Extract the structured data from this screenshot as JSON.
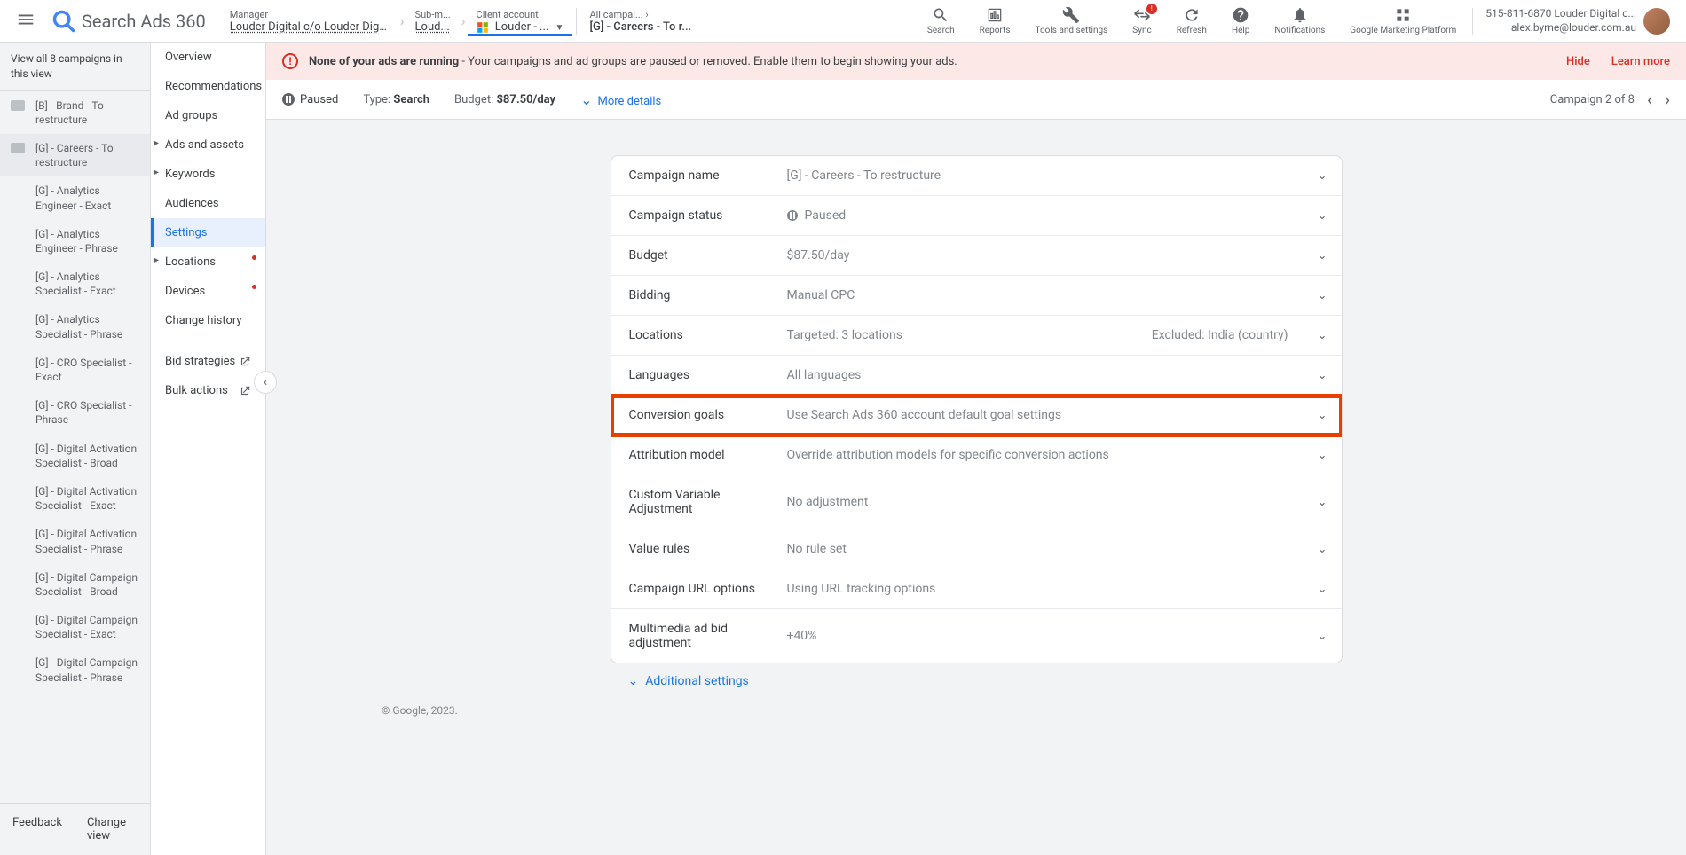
{
  "app": {
    "name": "Search Ads 360"
  },
  "breadcrumb": {
    "manager": {
      "label": "Manager",
      "value": "Louder Digital c/o Louder Digital..."
    },
    "submanager": {
      "label": "Sub-m...",
      "value": "Loud..."
    },
    "client": {
      "label": "Client account",
      "value": "Louder - ..."
    },
    "scope": {
      "label": "All campai...",
      "value": "[G] - Careers - To r..."
    }
  },
  "topActions": {
    "search": "Search",
    "reports": "Reports",
    "tools": "Tools and settings",
    "sync": "Sync",
    "syncBadge": "!",
    "refresh": "Refresh",
    "help": "Help",
    "notifications": "Notifications",
    "gmp": "Google Marketing Platform"
  },
  "user": {
    "line1": "515-811-6870 Louder Digital c...",
    "line2": "alex.byrne@louder.com.au"
  },
  "sidebar": {
    "viewAll": "View all 8 campaigns in this view",
    "items": [
      {
        "label": "[B] - Brand - To restructure",
        "icon": true
      },
      {
        "label": "[G] - Careers - To restructure",
        "icon": true,
        "selected": true
      },
      {
        "label": "[G] - Analytics Engineer - Exact"
      },
      {
        "label": "[G] - Analytics Engineer - Phrase"
      },
      {
        "label": "[G] - Analytics Specialist - Exact"
      },
      {
        "label": "[G] - Analytics Specialist - Phrase"
      },
      {
        "label": "[G] - CRO Specialist - Exact"
      },
      {
        "label": "[G] - CRO Specialist - Phrase"
      },
      {
        "label": "[G] - Digital Activation Specialist - Broad"
      },
      {
        "label": "[G] - Digital Activation Specialist - Exact"
      },
      {
        "label": "[G] - Digital Activation Specialist - Phrase"
      },
      {
        "label": "[G] - Digital Campaign Specialist - Broad"
      },
      {
        "label": "[G] - Digital Campaign Specialist - Exact"
      },
      {
        "label": "[G] - Digital Campaign Specialist - Phrase"
      }
    ],
    "footer": {
      "feedback": "Feedback",
      "changeView": "Change view"
    }
  },
  "nav2": {
    "items": [
      {
        "label": "Overview"
      },
      {
        "label": "Recommendations"
      },
      {
        "label": "Ad groups"
      },
      {
        "label": "Ads and assets",
        "exp": true
      },
      {
        "label": "Keywords",
        "exp": true
      },
      {
        "label": "Audiences"
      },
      {
        "label": "Settings",
        "active": true
      },
      {
        "label": "Locations",
        "exp": true,
        "dot": true
      },
      {
        "label": "Devices",
        "dot": true
      },
      {
        "label": "Change history"
      }
    ],
    "extras": [
      {
        "label": "Bid strategies"
      },
      {
        "label": "Bulk actions"
      }
    ]
  },
  "alert": {
    "strong": "None of your ads are running",
    "rest": " - Your campaigns and ad groups are paused or removed. Enable them to begin showing your ads.",
    "hide": "Hide",
    "learn": "Learn more"
  },
  "summary": {
    "status": "Paused",
    "typeLabel": "Type:",
    "typeValue": "Search",
    "budgetLabel": "Budget:",
    "budgetValue": "$87.50/day",
    "more": "More details",
    "position": "Campaign 2 of 8"
  },
  "settings": [
    {
      "label": "Campaign name",
      "value": "[G] - Careers - To restructure"
    },
    {
      "label": "Campaign status",
      "value": "Paused",
      "paused": true
    },
    {
      "label": "Budget",
      "value": "$87.50/day"
    },
    {
      "label": "Bidding",
      "value": "Manual CPC"
    },
    {
      "label": "Locations",
      "value": "Targeted: 3 locations",
      "extra": "Excluded: India (country)"
    },
    {
      "label": "Languages",
      "value": "All languages"
    },
    {
      "label": "Conversion goals",
      "value": "Use Search Ads 360 account default goal settings",
      "highlight": true
    },
    {
      "label": "Attribution model",
      "value": "Override attribution models for specific conversion actions"
    },
    {
      "label": "Custom Variable Adjustment",
      "value": "No adjustment"
    },
    {
      "label": "Value rules",
      "value": "No rule set"
    },
    {
      "label": "Campaign URL options",
      "value": "Using URL tracking options"
    },
    {
      "label": "Multimedia ad bid adjustment",
      "value": "+40%"
    }
  ],
  "additional": "Additional settings",
  "copyright": "© Google, 2023."
}
